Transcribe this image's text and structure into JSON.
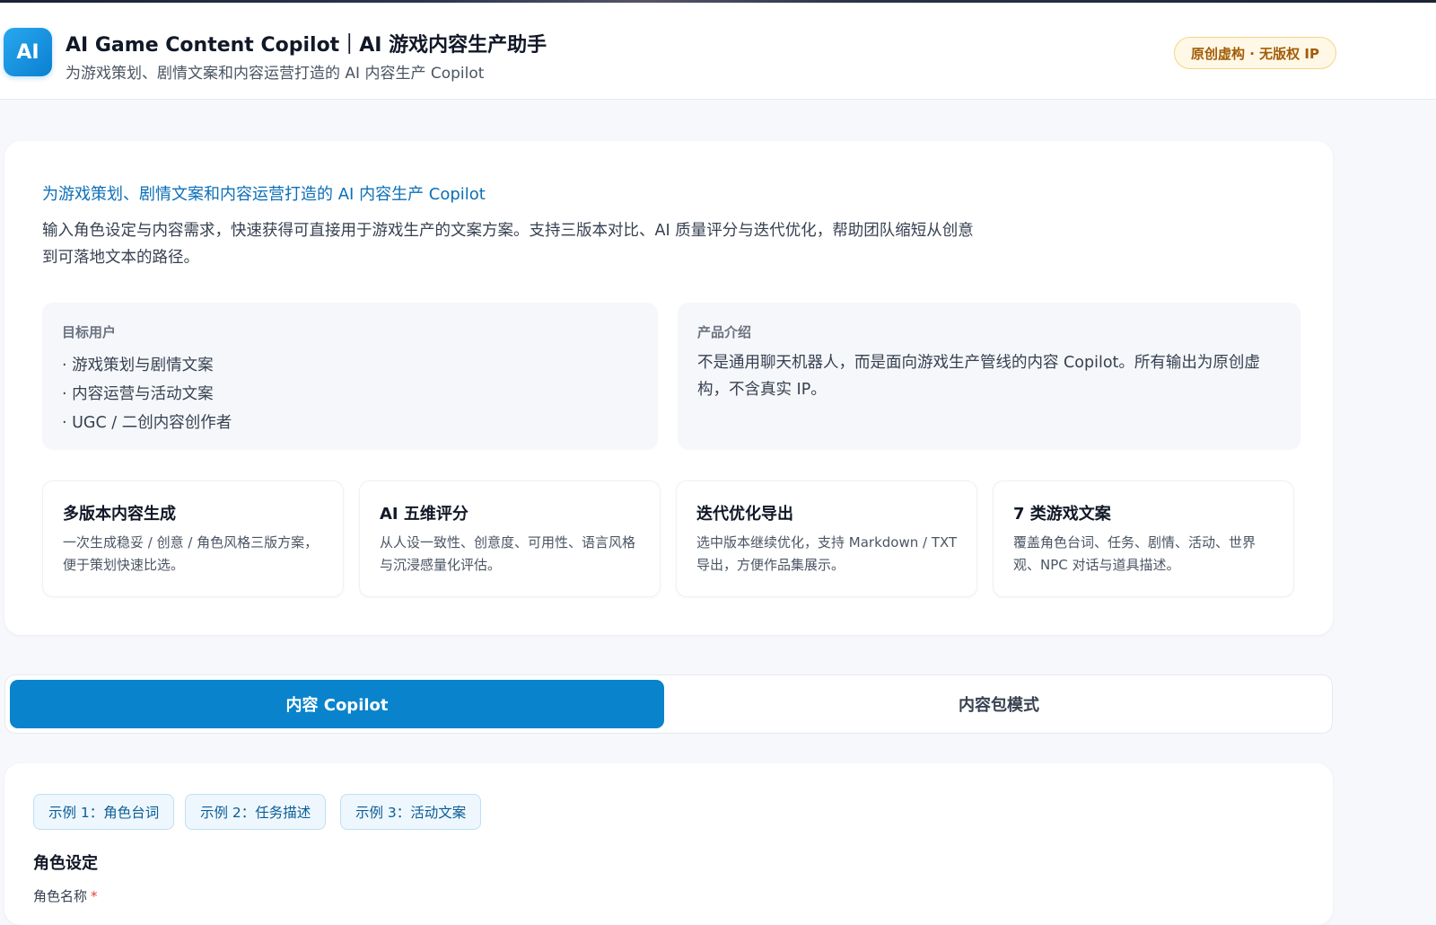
{
  "header": {
    "logo_text": "AI",
    "title": "AI Game Content Copilot｜AI 游戏内容生产助手",
    "subtitle": "为游戏策划、剧情文案和内容运营打造的 AI 内容生产 Copilot",
    "badge": "原创虚构 · 无版权 IP"
  },
  "hero": {
    "tagline": "为游戏策划、剧情文案和内容运营打造的 AI 内容生产 Copilot",
    "description": "输入角色设定与内容需求，快速获得可直接用于游戏生产的文案方案。支持三版本对比、AI 质量评分与迭代优化，帮助团队缩短从创意到可落地文本的路径。",
    "target_users": {
      "label": "目标用户",
      "items": [
        "· 游戏策划与剧情文案",
        "· 内容运营与活动文案",
        "· UGC / 二创内容创作者"
      ]
    },
    "product_intro": {
      "label": "产品介绍",
      "text": "不是通用聊天机器人，而是面向游戏生产管线的内容 Copilot。所有输出为原创虚构，不含真实 IP。"
    },
    "features": [
      {
        "title": "多版本内容生成",
        "desc": "一次生成稳妥 / 创意 / 角色风格三版方案，便于策划快速比选。"
      },
      {
        "title": "AI 五维评分",
        "desc": "从人设一致性、创意度、可用性、语言风格与沉浸感量化评估。"
      },
      {
        "title": "迭代优化导出",
        "desc": "选中版本继续优化，支持 Markdown / TXT 导出，方便作品集展示。"
      },
      {
        "title": "7 类游戏文案",
        "desc": "覆盖角色台词、任务、剧情、活动、世界观、NPC 对话与道具描述。"
      }
    ]
  },
  "tabs": [
    {
      "label": "内容 Copilot",
      "active": true
    },
    {
      "label": "内容包模式",
      "active": false
    }
  ],
  "form": {
    "examples": [
      "示例 1：角色台词",
      "示例 2：任务描述",
      "示例 3：活动文案"
    ],
    "section_title": "角色设定",
    "field_label": "角色名称",
    "required_mark": "*"
  },
  "colors": {
    "primary": "#0983cc",
    "accent_text": "#0b6fb8",
    "badge_bg": "#fff8e6",
    "badge_text": "#a15c07"
  }
}
